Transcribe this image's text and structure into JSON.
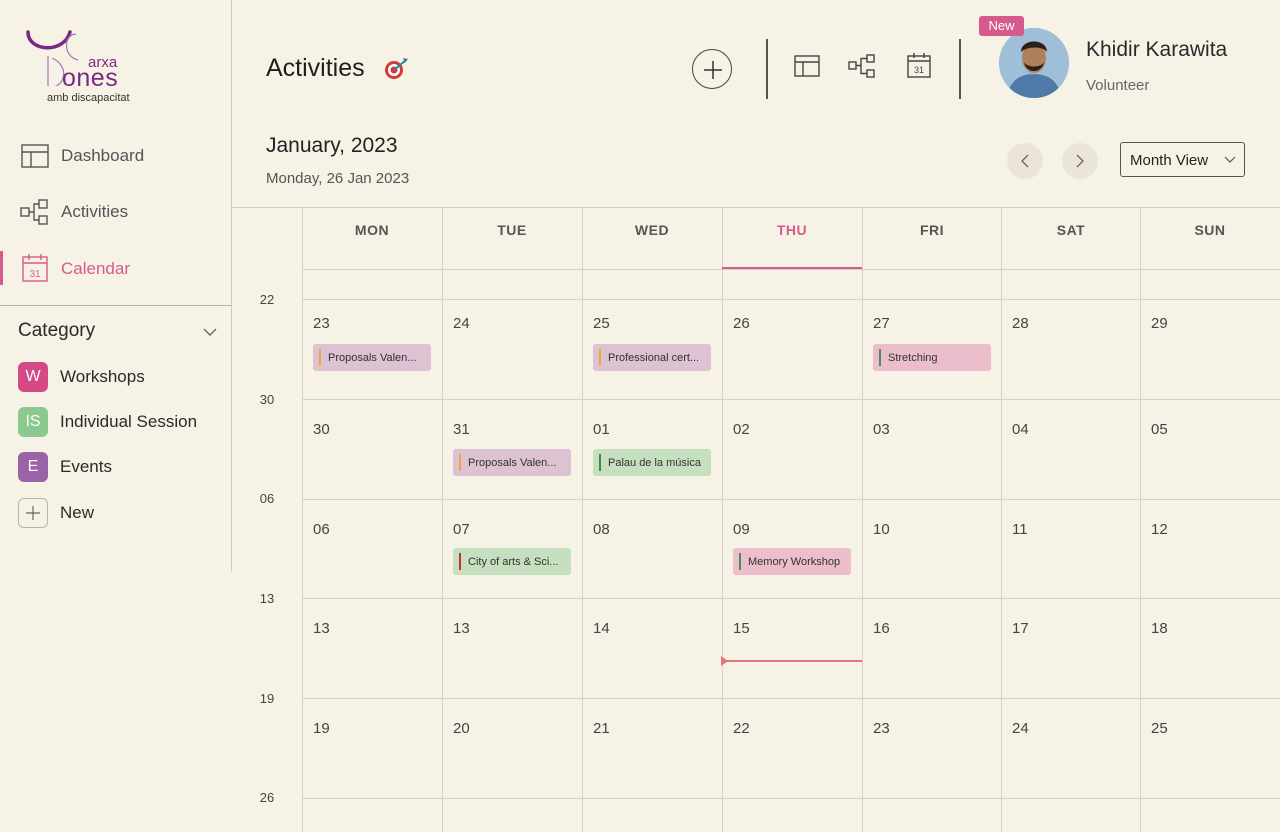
{
  "logo": {
    "line1": "arxa",
    "line2": "ones",
    "line3": "amb discapacitat"
  },
  "sidebar": {
    "items": [
      {
        "label": "Dashboard",
        "icon": "dashboard-icon"
      },
      {
        "label": "Activities",
        "icon": "activities-icon"
      },
      {
        "label": "Calendar",
        "icon": "calendar-icon",
        "active": true,
        "calendar_day": "31"
      }
    ]
  },
  "category": {
    "title": "Category",
    "items": [
      {
        "badge": "W",
        "label": "Workshops",
        "color": "#d54a85"
      },
      {
        "badge": "IS",
        "label": "Individual Session",
        "color": "#8bc98e"
      },
      {
        "badge": "E",
        "label": "Events",
        "color": "#9a63a8"
      },
      {
        "badge": "+",
        "label": "New",
        "color": "transparent"
      }
    ]
  },
  "header": {
    "title": "Activities",
    "calendar_icon_day": "31",
    "new_badge": "New",
    "user_name": "Khidir Karawita",
    "user_role": "Volunteer"
  },
  "month": {
    "title": "January, 2023",
    "subtitle": "Monday, 26 Jan 2023",
    "view": "Month View"
  },
  "calendar": {
    "days": [
      "MON",
      "TUE",
      "WED",
      "THU",
      "FRI",
      "SAT",
      "SUN"
    ],
    "today_index": 3,
    "week_labels": [
      "22",
      "30",
      "06",
      "13",
      "19",
      "26"
    ],
    "weeks": [
      [
        "23",
        "24",
        "25",
        "26",
        "27",
        "28",
        "29"
      ],
      [
        "30",
        "31",
        "01",
        "02",
        "03",
        "04",
        "05"
      ],
      [
        "06",
        "07",
        "08",
        "09",
        "10",
        "11",
        "12"
      ],
      [
        "13",
        "13",
        "14",
        "15",
        "16",
        "17",
        "18"
      ],
      [
        "19",
        "20",
        "21",
        "22",
        "23",
        "24",
        "25"
      ]
    ],
    "events": [
      {
        "week": 0,
        "day": 0,
        "label": "Proposals Valen...",
        "bg": "#dcc2d2",
        "bar": "#f0a832"
      },
      {
        "week": 0,
        "day": 2,
        "label": "Professional cert...",
        "bg": "#dcc2d2",
        "bar": "#f0a832"
      },
      {
        "week": 0,
        "day": 4,
        "label": "Stretching",
        "bg": "#ecbdcb",
        "bar": "#4d8c55"
      },
      {
        "week": 1,
        "day": 1,
        "label": "Proposals Valen...",
        "bg": "#dcc2d2",
        "bar": "#f0a832"
      },
      {
        "week": 1,
        "day": 2,
        "label": "Palau de la música",
        "bg": "#c6dfbe",
        "bar": "#3a8c45"
      },
      {
        "week": 2,
        "day": 1,
        "label": "City of arts & Sci...",
        "bg": "#c6dfbe",
        "bar": "#c8302f"
      },
      {
        "week": 2,
        "day": 3,
        "label": "Memory Workshop",
        "bg": "#ecbdcb",
        "bar": "#4d8c55"
      }
    ]
  },
  "colors": {
    "accent": "#d75a8c",
    "now_line": "#e9737d"
  }
}
